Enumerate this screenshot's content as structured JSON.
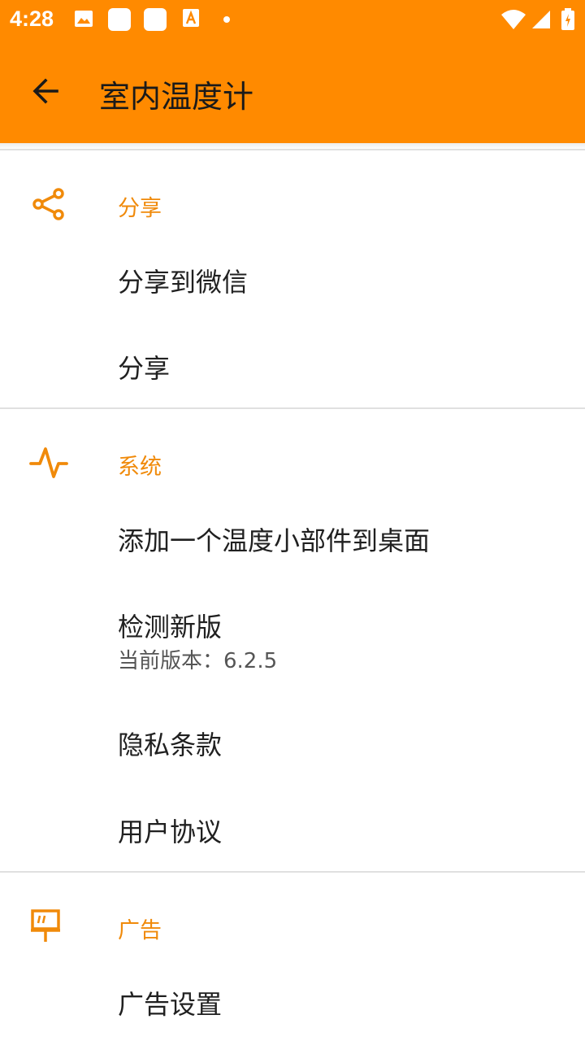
{
  "status_bar": {
    "time": "4:28",
    "icons": [
      "image-icon",
      "app-icon",
      "app-icon",
      "accessibility-icon",
      "dot-icon",
      "wifi-icon",
      "signal-icon",
      "battery-icon"
    ]
  },
  "app_bar": {
    "title": "室内温度计",
    "background": "#FF8A00"
  },
  "sections": {
    "share": {
      "title": "分享",
      "icon": "share-icon",
      "items": [
        {
          "label": "分享到微信"
        },
        {
          "label": "分享"
        }
      ]
    },
    "system": {
      "title": "系统",
      "icon": "pulse-icon",
      "items": [
        {
          "label": "添加一个温度小部件到桌面"
        },
        {
          "label": "检测新版",
          "summary": "当前版本：6.2.5"
        },
        {
          "label": "隐私条款"
        },
        {
          "label": "用户协议"
        }
      ]
    },
    "ads": {
      "title": "广告",
      "icon": "billboard-icon",
      "items": [
        {
          "label": "广告设置"
        }
      ]
    }
  },
  "colors": {
    "accent": "#FF8A00",
    "category_text": "#F08A0A",
    "divider": "#E0E0E0"
  }
}
